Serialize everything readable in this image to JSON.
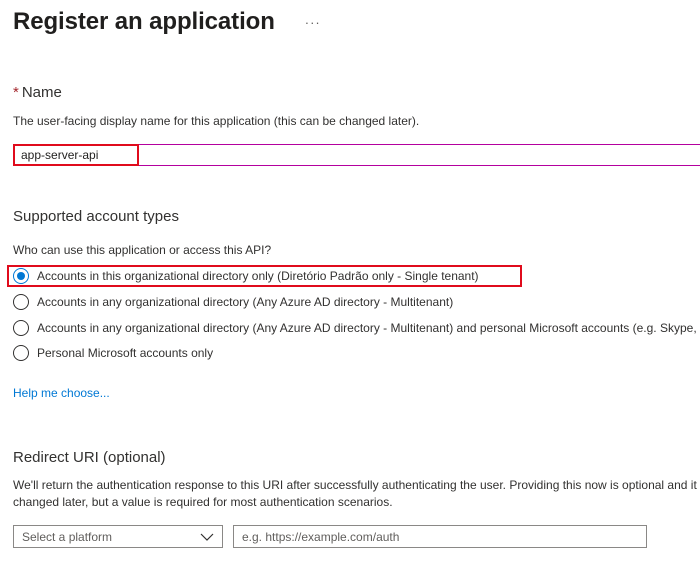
{
  "header": {
    "title": "Register an application",
    "more_label": "···"
  },
  "name_section": {
    "required_marker": "*",
    "label": "Name",
    "help": "The user-facing display name for this application (this can be changed later).",
    "value": "app-server-api"
  },
  "account_types": {
    "label": "Supported account types",
    "question": "Who can use this application or access this API?",
    "options": [
      {
        "label": "Accounts in this organizational directory only (Diretório Padrão only - Single tenant)",
        "selected": true
      },
      {
        "label": "Accounts in any organizational directory (Any Azure AD directory - Multitenant)",
        "selected": false
      },
      {
        "label": "Accounts in any organizational directory (Any Azure AD directory - Multitenant) and personal Microsoft accounts (e.g. Skype, Xbox)",
        "selected": false
      },
      {
        "label": "Personal Microsoft accounts only",
        "selected": false
      }
    ],
    "help_link": "Help me choose..."
  },
  "redirect": {
    "label": "Redirect URI (optional)",
    "help_line1": "We'll return the authentication response to this URI after successfully authenticating the user. Providing this now is optional and it can be",
    "help_line2": "changed later, but a value is required for most authentication scenarios.",
    "platform_select": "Select a platform",
    "uri_placeholder": "e.g. https://example.com/auth"
  },
  "colors": {
    "accent": "#0078d4",
    "highlight": "#e00b1c",
    "focus_border": "#b4009e"
  }
}
